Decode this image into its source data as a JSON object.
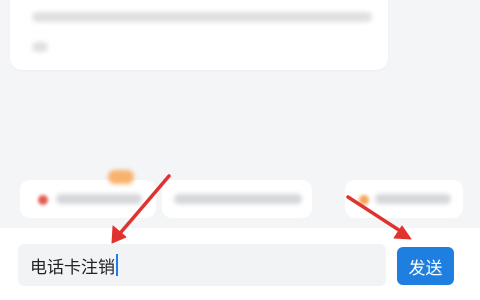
{
  "input": {
    "value": "电话卡注销"
  },
  "send_button": {
    "label": "发送"
  },
  "colors": {
    "accent": "#1e7fe0",
    "annotation_arrow": "#e0332f",
    "background": "#f4f5f7"
  },
  "icons": {
    "annotation": "red-arrow-icon"
  }
}
